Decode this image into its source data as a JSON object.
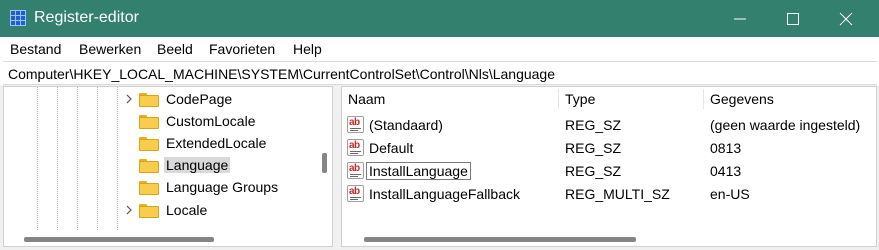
{
  "window": {
    "title": "Register-editor",
    "accent": "#33806f"
  },
  "menu": [
    "Bestand",
    "Bewerken",
    "Beeld",
    "Favorieten",
    "Help"
  ],
  "address": "Computer\\HKEY_LOCAL_MACHINE\\SYSTEM\\CurrentControlSet\\Control\\Nls\\Language",
  "tree": {
    "items": [
      {
        "label": "CodePage",
        "expandable": true
      },
      {
        "label": "CustomLocale",
        "expandable": false
      },
      {
        "label": "ExtendedLocale",
        "expandable": false
      },
      {
        "label": "Language",
        "expandable": false,
        "selected": true
      },
      {
        "label": "Language Groups",
        "expandable": false
      },
      {
        "label": "Locale",
        "expandable": true
      }
    ]
  },
  "list": {
    "columns": [
      "Naam",
      "Type",
      "Gegevens"
    ],
    "rows": [
      {
        "name": "(Standaard)",
        "type": "REG_SZ",
        "data": "(geen waarde ingesteld)"
      },
      {
        "name": "Default",
        "type": "REG_SZ",
        "data": "0813"
      },
      {
        "name": "InstallLanguage",
        "type": "REG_SZ",
        "data": "0413",
        "focused": true
      },
      {
        "name": "InstallLanguageFallback",
        "type": "REG_MULTI_SZ",
        "data": "en-US"
      }
    ]
  },
  "icons": {
    "value": "string-value-icon",
    "folder": "folder-icon",
    "chevron": "chevron-right-icon"
  }
}
